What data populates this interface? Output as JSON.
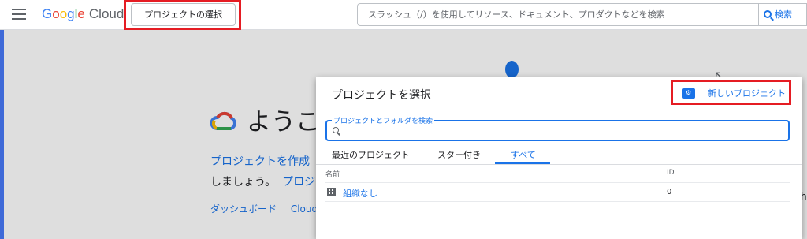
{
  "topbar": {
    "logo": {
      "g": "G",
      "o1": "o",
      "o2": "o",
      "g2": "g",
      "l": "l",
      "e": "e",
      "cloud": "Cloud"
    },
    "project_select_label": "プロジェクトの選択",
    "search_placeholder": "スラッシュ（/）を使用してリソース、ドキュメント、プロダクトなどを検索",
    "search_button_label": "検索"
  },
  "background": {
    "welcome_title": "ようこ",
    "line1": "プロジェクトを作成",
    "line2_text": "しましょう。",
    "line2_link": "プロジ",
    "links": [
      "ダッシュボード",
      "Cloud"
    ],
    "right_fragment": "hi"
  },
  "dialog": {
    "title": "プロジェクトを選択",
    "new_project_label": "新しいプロジェクト",
    "search_field_label": "プロジェクトとフォルダを検索",
    "tabs": [
      {
        "label": "最近のプロジェクト",
        "active": false
      },
      {
        "label": "スター付き",
        "active": false
      },
      {
        "label": "すべて",
        "active": true
      }
    ],
    "columns": {
      "name": "名前",
      "id": "ID"
    },
    "rows": [
      {
        "name": "組織なし",
        "id": "0"
      }
    ]
  },
  "colors": {
    "accent": "#1a73e8",
    "highlight": "#e51c23"
  },
  "icons": {
    "menu": "menu-icon",
    "search": "search-icon",
    "new_project": "folder-gear-icon",
    "org": "building-icon"
  }
}
